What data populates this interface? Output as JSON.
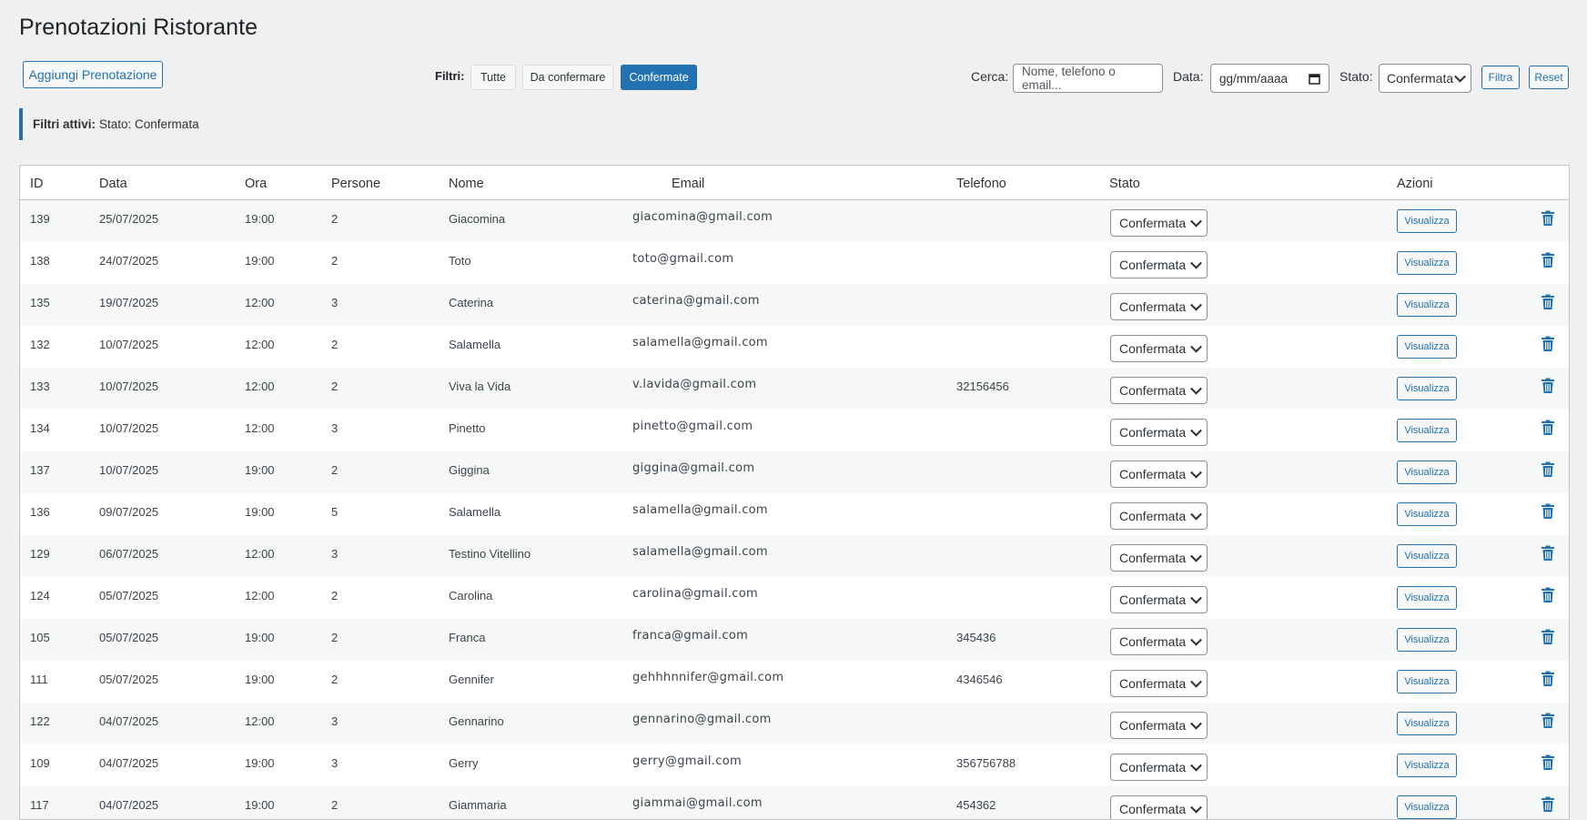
{
  "header": {
    "title": "Prenotazioni Ristorante",
    "add_label": "Aggiungi Prenotazione"
  },
  "filters": {
    "label": "Filtri:",
    "buttons": [
      {
        "label": "Tutte"
      },
      {
        "label": "Da confermare"
      },
      {
        "label": "Confermate"
      }
    ],
    "active": "Confermate",
    "search_label": "Cerca:",
    "search_placeholder": "Nome, telefono o email...",
    "date_label": "Data:",
    "date_placeholder": "gg/mm/aaaa",
    "status_label": "Stato:",
    "status_value": "Confermata",
    "filter_label": "Filtra",
    "reset_label": "Reset"
  },
  "notice": {
    "label": "Filtri attivi:",
    "text": "Stato: Confermata"
  },
  "table": {
    "columns": [
      "ID",
      "Data",
      "Ora",
      "Persone",
      "Nome",
      "Email",
      "Telefono",
      "Stato",
      "Azioni"
    ],
    "view_label": "Visualizza",
    "rows": [
      {
        "id": "139",
        "data": "25/07/2025",
        "ora": "19:00",
        "persone": "2",
        "nome": "Giacomina",
        "email": "giacomina@gmail.com",
        "telefono": "",
        "stato": "Confermata"
      },
      {
        "id": "138",
        "data": "24/07/2025",
        "ora": "19:00",
        "persone": "2",
        "nome": "Toto",
        "email": "toto@gmail.com",
        "telefono": "",
        "stato": "Confermata"
      },
      {
        "id": "135",
        "data": "19/07/2025",
        "ora": "12:00",
        "persone": "3",
        "nome": "Caterina",
        "email": "caterina@gmail.com",
        "telefono": "",
        "stato": "Confermata"
      },
      {
        "id": "132",
        "data": "10/07/2025",
        "ora": "12:00",
        "persone": "2",
        "nome": "Salamella",
        "email": "salamella@gmail.com",
        "telefono": "",
        "stato": "Confermata"
      },
      {
        "id": "133",
        "data": "10/07/2025",
        "ora": "12:00",
        "persone": "2",
        "nome": "Viva la Vida",
        "email": "v.lavida@gmail.com",
        "telefono": "32156456",
        "stato": "Confermata"
      },
      {
        "id": "134",
        "data": "10/07/2025",
        "ora": "12:00",
        "persone": "3",
        "nome": "Pinetto",
        "email": "pinetto@gmail.com",
        "telefono": "",
        "stato": "Confermata"
      },
      {
        "id": "137",
        "data": "10/07/2025",
        "ora": "19:00",
        "persone": "2",
        "nome": "Giggina",
        "email": "giggina@gmail.com",
        "telefono": "",
        "stato": "Confermata"
      },
      {
        "id": "136",
        "data": "09/07/2025",
        "ora": "19:00",
        "persone": "5",
        "nome": "Salamella",
        "email": "salamella@gmail.com",
        "telefono": "",
        "stato": "Confermata"
      },
      {
        "id": "129",
        "data": "06/07/2025",
        "ora": "12:00",
        "persone": "3",
        "nome": "Testino Vitellino",
        "email": "salamella@gmail.com",
        "telefono": "",
        "stato": "Confermata"
      },
      {
        "id": "124",
        "data": "05/07/2025",
        "ora": "12:00",
        "persone": "2",
        "nome": "Carolina",
        "email": "carolina@gmail.com",
        "telefono": "",
        "stato": "Confermata"
      },
      {
        "id": "105",
        "data": "05/07/2025",
        "ora": "19:00",
        "persone": "2",
        "nome": "Franca",
        "email": "franca@gmail.com",
        "telefono": "345436",
        "stato": "Confermata"
      },
      {
        "id": "111",
        "data": "05/07/2025",
        "ora": "19:00",
        "persone": "2",
        "nome": "Gennifer",
        "email": "gehhhnnifer@gmail.com",
        "telefono": "4346546",
        "stato": "Confermata"
      },
      {
        "id": "122",
        "data": "04/07/2025",
        "ora": "12:00",
        "persone": "3",
        "nome": "Gennarino",
        "email": "gennarino@gmail.com",
        "telefono": "",
        "stato": "Confermata"
      },
      {
        "id": "109",
        "data": "04/07/2025",
        "ora": "19:00",
        "persone": "3",
        "nome": "Gerry",
        "email": "gerry@gmail.com",
        "telefono": "356756788",
        "stato": "Confermata"
      },
      {
        "id": "117",
        "data": "04/07/2025",
        "ora": "19:00",
        "persone": "2",
        "nome": "Giammaria",
        "email": "giammai@gmail.com",
        "telefono": "454362",
        "stato": "Confermata"
      }
    ]
  },
  "icons": {
    "trash": "trash-icon",
    "dropdown": "chevron-down-icon",
    "calendar": "calendar-icon"
  },
  "colors": {
    "accent": "#2271b1",
    "background": "#f0f0f1"
  }
}
